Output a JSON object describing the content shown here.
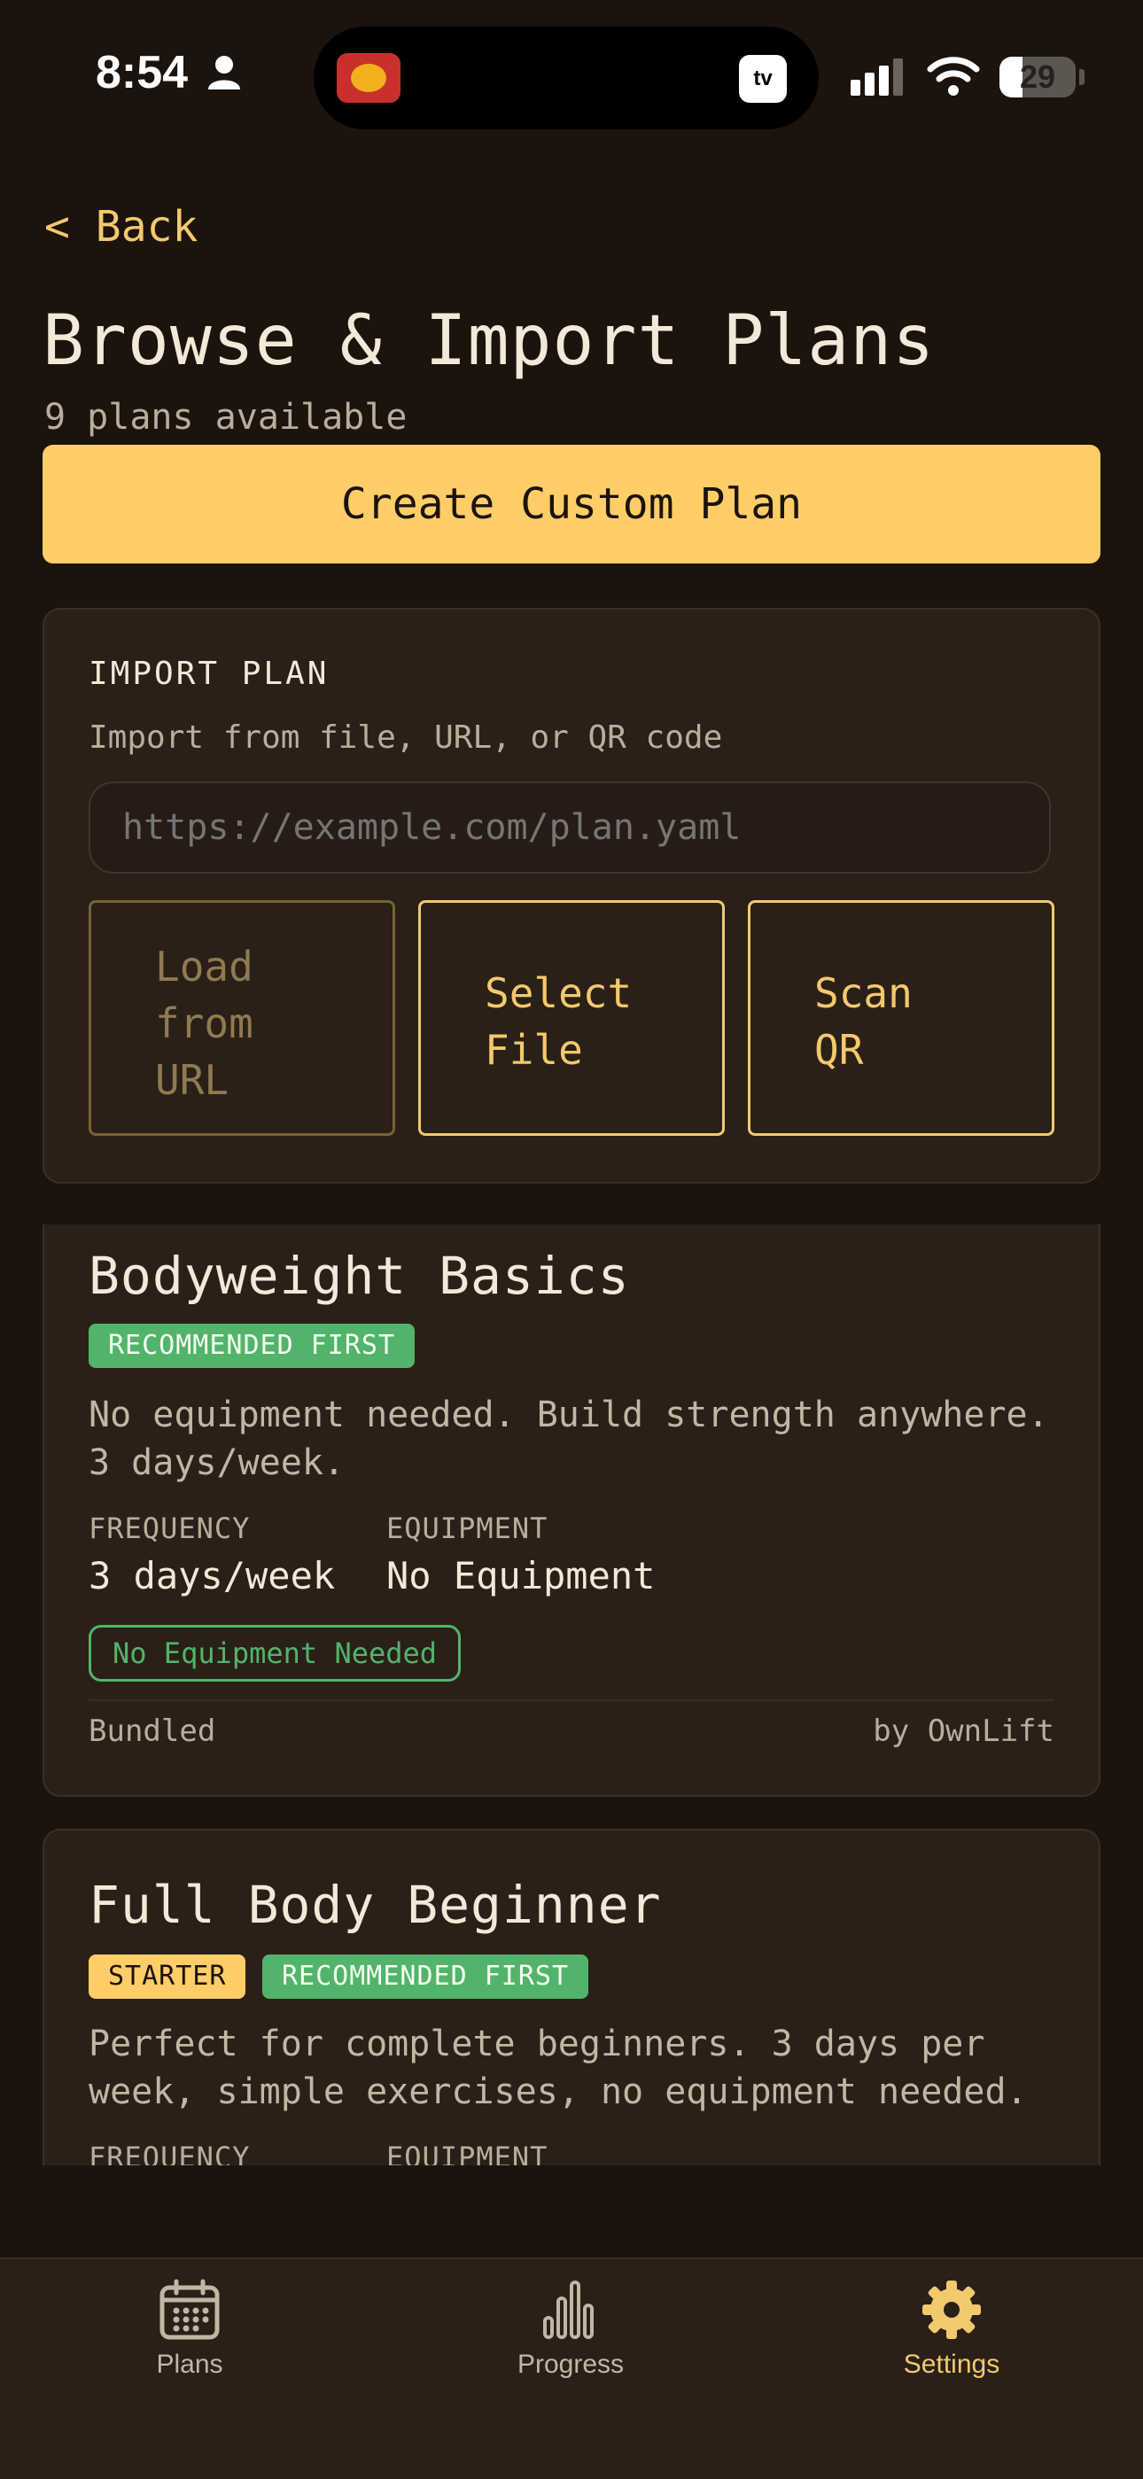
{
  "status_bar": {
    "time": "8:54",
    "battery": "29",
    "island_badge": "tv"
  },
  "header": {
    "back_label": "< Back",
    "title": "Browse & Import Plans",
    "subtitle": "9 plans available"
  },
  "create_button": "Create Custom Plan",
  "import": {
    "heading": "IMPORT PLAN",
    "description": "Import from file, URL, or QR code",
    "url_placeholder": "https://example.com/plan.yaml",
    "buttons": {
      "load": [
        "Load",
        "from",
        "URL"
      ],
      "select": [
        "Select",
        "File"
      ],
      "scan": [
        "Scan",
        "QR"
      ]
    }
  },
  "plans": [
    {
      "title": "Bodyweight Basics",
      "badges": [
        "RECOMMENDED FIRST"
      ],
      "description_lines": [
        "No equipment needed. Build strength anywhere.",
        "3 days/week."
      ],
      "frequency_label": "FREQUENCY",
      "frequency": "3 days/week",
      "equipment_label": "EQUIPMENT",
      "equipment": "No Equipment",
      "tag": "No Equipment Needed",
      "source": "Bundled",
      "author": "by OwnLift"
    },
    {
      "title": "Full Body Beginner",
      "badges": [
        "STARTER",
        "RECOMMENDED FIRST"
      ],
      "description_lines": [
        "Perfect for complete beginners. 3 days per",
        "week, simple exercises, no equipment needed."
      ],
      "frequency_label": "FREQUENCY",
      "equipment_label": "EQUIPMENT"
    }
  ],
  "tabs": [
    {
      "label": "Plans",
      "icon": "calendar-icon"
    },
    {
      "label": "Progress",
      "icon": "bar-chart-icon"
    },
    {
      "label": "Settings",
      "icon": "gear-icon",
      "active": true
    }
  ],
  "colors": {
    "accent": "#fecd67",
    "green": "#52b46b",
    "background": "#1c130d",
    "card": "#2a2018"
  }
}
